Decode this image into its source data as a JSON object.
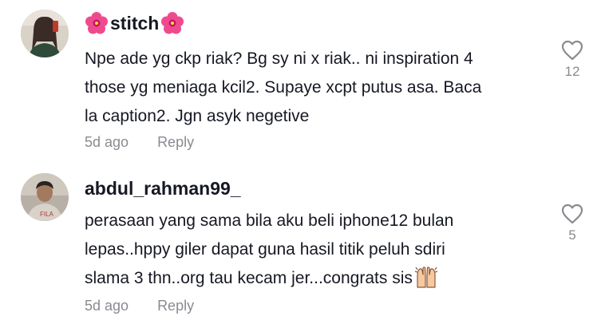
{
  "comments": [
    {
      "username": "stitch",
      "text_lines": [
        "Npe ade yg ckp riak? Bg sy ni x riak.. ni inspiration 4",
        "those yg meniaga kcil2. Supaye xcpt putus asa. Baca",
        "la caption2. Jgn asyk negetive"
      ],
      "time": "5d ago",
      "reply_label": "Reply",
      "like_count": "12"
    },
    {
      "username": "abdul_rahman99_",
      "text_lines": [
        "perasaan yang sama bila aku beli iphone12 bulan",
        "lepas..hppy giler dapat guna hasil titik peluh sdiri",
        "slama 3 thn..org tau kecam jer...congrats sis"
      ],
      "time": "5d ago",
      "reply_label": "Reply",
      "like_count": "5"
    }
  ],
  "icons": {
    "flower": "hibiscus-icon",
    "like": "heart-outline-icon",
    "hands": "raising-hands-icon"
  },
  "colors": {
    "primary_text": "#161823",
    "secondary_text": "#8a8b91",
    "flower": "#f04a8f"
  }
}
